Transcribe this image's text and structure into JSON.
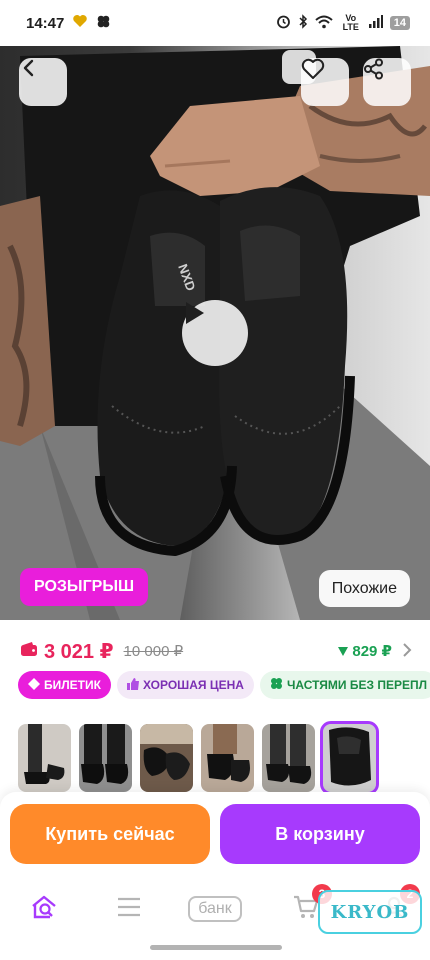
{
  "status_bar": {
    "time": "14:47",
    "network": "Vo LTE",
    "battery": "14",
    "icons": [
      "heart-check-icon",
      "clover-icon",
      "alarm-icon",
      "bluetooth-icon",
      "wifi-icon",
      "signal-icon",
      "battery-icon"
    ]
  },
  "hero": {
    "brand_on_shoe": "NXD",
    "promo_badge": "РОЗЫГРЫШ",
    "similar_button": "Похожие",
    "icons": [
      "back-arrow-icon",
      "heart-icon",
      "share-icon",
      "play-icon"
    ]
  },
  "price": {
    "current": "3 021 ₽",
    "old": "10 000 ₽",
    "cashback": "829 ₽",
    "colors": {
      "price": "#e8245c",
      "cashback": "#1aa153"
    }
  },
  "badges": [
    {
      "label": "БИЛЕТИК",
      "icon": "ticket-icon"
    },
    {
      "label": "ХОРОШАЯ ЦЕНА",
      "icon": "thumbs-up-icon"
    },
    {
      "label": "ЧАСТЯМИ БЕЗ ПЕРЕПЛ",
      "icon": "clover-icon"
    }
  ],
  "thumbnails": {
    "count": 6,
    "selected_index": 5
  },
  "actions": {
    "buy_now": "Купить сейчас",
    "add_to_cart": "В корзину",
    "colors": {
      "buy_now": "#ff8a2a",
      "add_to_cart": "#a73afd"
    }
  },
  "bottom_nav": {
    "bank_label": "банк",
    "cart_count": "3",
    "profile_count": "2",
    "watermark": "KRYOB",
    "icons": [
      "home-search-icon",
      "catalog-menu-icon",
      "bank-icon",
      "cart-icon",
      "profile-icon"
    ]
  }
}
